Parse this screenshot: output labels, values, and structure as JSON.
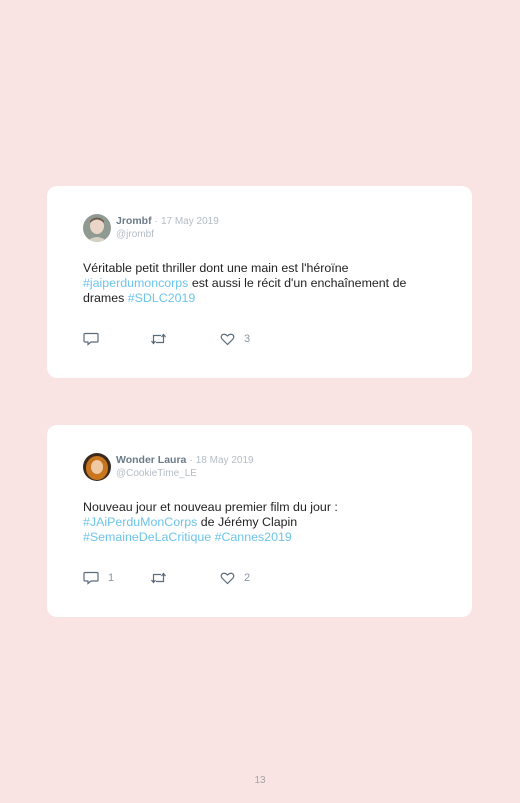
{
  "tweets": [
    {
      "author": "Jrombf",
      "date": "17 May 2019",
      "handle": "@jrombf",
      "text_parts": [
        {
          "text": "Véritable petit thriller dont une main est l'héroïne",
          "tag": false
        },
        {
          "text": "#jaiperdumoncorps",
          "tag": true
        },
        {
          "text": " est aussi le récit d'un enchaînement de drames ",
          "tag": false
        },
        {
          "text": "#SDLC2019",
          "tag": true
        }
      ],
      "replies": "",
      "retweets": "",
      "likes": "3"
    },
    {
      "author": "Wonder Laura",
      "date": "18 May 2019",
      "handle": "@CookieTime_LE",
      "text_parts": [
        {
          "text": "Nouveau jour et nouveau premier film du jour :",
          "tag": false
        },
        {
          "text": "#JAiPerduMonCorps",
          "tag": true
        },
        {
          "text": " de Jérémy Clapin",
          "tag": false
        },
        {
          "text": "#SemaineDeLaCritique",
          "tag": true
        },
        {
          "text": " ",
          "tag": false
        },
        {
          "text": "#Cannes2019",
          "tag": true
        }
      ],
      "replies": "1",
      "retweets": "",
      "likes": "2"
    }
  ],
  "separator": "·",
  "page_number": "13",
  "colors": {
    "background": "#f9e3e3",
    "hashtag": "#6cc4ea",
    "author": "#6b7a89",
    "muted": "#b3bcc5"
  }
}
